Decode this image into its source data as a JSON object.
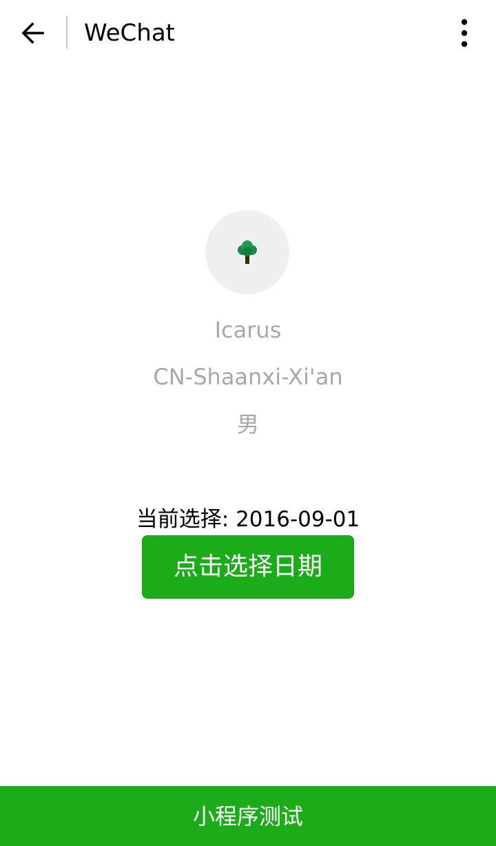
{
  "navbar": {
    "title": "WeChat",
    "back_icon": "arrow-left-icon",
    "more_icon": "more-vertical-icon"
  },
  "profile": {
    "avatar_icon": "tree-icon",
    "nickname": "Icarus",
    "location": "CN-Shaanxi-Xi'an",
    "gender": "男"
  },
  "picker": {
    "label": "当前选择: 2016-09-01",
    "button_label": "点击选择日期"
  },
  "bottom_bar": {
    "label": "小程序测试"
  },
  "colors": {
    "primary": "#1aad19",
    "secondary_text": "#a8a8a8",
    "avatar_bg": "#efefef"
  }
}
